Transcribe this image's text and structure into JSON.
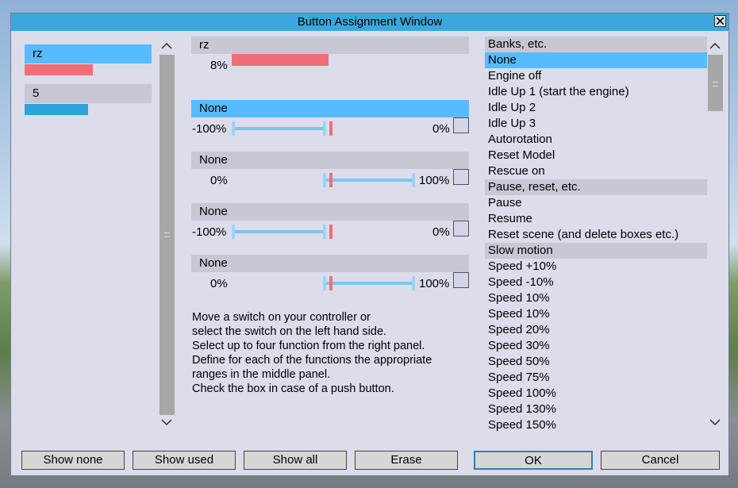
{
  "window": {
    "title": "Button Assignment Window"
  },
  "devices": [
    {
      "label": "rz",
      "selected": true,
      "level": 0.55
    },
    {
      "label": "5",
      "selected": false,
      "level": 0.5
    }
  ],
  "current": {
    "name": "rz",
    "value_text": "8%",
    "level": 0.08
  },
  "functions": [
    {
      "name": "None",
      "selected": true,
      "left_label": "-100%",
      "right_label": "0%"
    },
    {
      "name": "None",
      "selected": false,
      "left_label": "0%",
      "right_label": "100%"
    },
    {
      "name": "None",
      "selected": false,
      "left_label": "-100%",
      "right_label": "0%"
    },
    {
      "name": "None",
      "selected": false,
      "left_label": "0%",
      "right_label": "100%"
    }
  ],
  "help": [
    "Move a switch on your controller or",
    "select the switch on the left hand side.",
    "Select up to four function from the right panel.",
    "Define for each of the functions the appropriate",
    "ranges in the middle panel.",
    "Check the box in case of a push button."
  ],
  "list": [
    {
      "label": "Banks, etc.",
      "type": "header"
    },
    {
      "label": "None",
      "type": "item",
      "selected": true
    },
    {
      "label": "Engine off",
      "type": "item"
    },
    {
      "label": "Idle Up 1 (start the engine)",
      "type": "item"
    },
    {
      "label": "Idle Up 2",
      "type": "item"
    },
    {
      "label": "Idle Up 3",
      "type": "item"
    },
    {
      "label": "Autorotation",
      "type": "item"
    },
    {
      "label": "Reset Model",
      "type": "item"
    },
    {
      "label": "Rescue on",
      "type": "item"
    },
    {
      "label": "Pause, reset, etc.",
      "type": "header"
    },
    {
      "label": "Pause",
      "type": "item"
    },
    {
      "label": "Resume",
      "type": "item"
    },
    {
      "label": "Reset scene (and delete boxes etc.)",
      "type": "item"
    },
    {
      "label": "Slow motion",
      "type": "header"
    },
    {
      "label": "Speed +10%",
      "type": "item"
    },
    {
      "label": "Speed -10%",
      "type": "item"
    },
    {
      "label": "Speed 10%",
      "type": "item"
    },
    {
      "label": "Speed 10%",
      "type": "item"
    },
    {
      "label": "Speed 20%",
      "type": "item"
    },
    {
      "label": "Speed 30%",
      "type": "item"
    },
    {
      "label": "Speed 50%",
      "type": "item"
    },
    {
      "label": "Speed 75%",
      "type": "item"
    },
    {
      "label": "Speed 100%",
      "type": "item"
    },
    {
      "label": "Speed 130%",
      "type": "item"
    },
    {
      "label": "Speed 150%",
      "type": "item"
    }
  ],
  "buttons": {
    "show_none": "Show none",
    "show_used": "Show used",
    "show_all": "Show all",
    "erase": "Erase",
    "ok": "OK",
    "cancel": "Cancel"
  },
  "colors": {
    "selection": "#56bbff",
    "title_bar": "#3aa8dc",
    "red_bar": "#f06e78",
    "blue_bar": "#2ea3d9"
  }
}
